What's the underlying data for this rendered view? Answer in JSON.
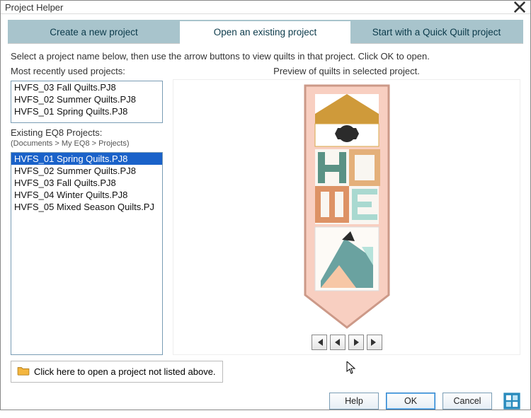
{
  "window": {
    "title": "Project Helper"
  },
  "tabs": {
    "create": "Create a new project",
    "open": "Open an existing project",
    "quick": "Start with a Quick Quilt project"
  },
  "instructions": "Select a project name below, then use the arrow buttons to view quilts in that project. Click OK to open.",
  "recent": {
    "label": "Most recently used projects:",
    "items": [
      "HVFS_03 Fall Quilts.PJ8",
      "HVFS_02 Summer Quilts.PJ8",
      "HVFS_01 Spring Quilts.PJ8"
    ]
  },
  "existing": {
    "label": "Existing EQ8 Projects:",
    "path": "(Documents > My EQ8 > Projects)",
    "items": [
      "HVFS_01 Spring Quilts.PJ8",
      "HVFS_02 Summer Quilts.PJ8",
      "HVFS_03 Fall Quilts.PJ8",
      "HVFS_04 Winter Quilts.PJ8",
      "HVFS_05 Mixed Season Quilts.PJ"
    ],
    "selected_index": 0
  },
  "preview": {
    "label": "Preview of quilts in selected project."
  },
  "open_other": {
    "label": "Click here to open a project not listed above."
  },
  "buttons": {
    "help": "Help",
    "ok": "OK",
    "cancel": "Cancel"
  }
}
